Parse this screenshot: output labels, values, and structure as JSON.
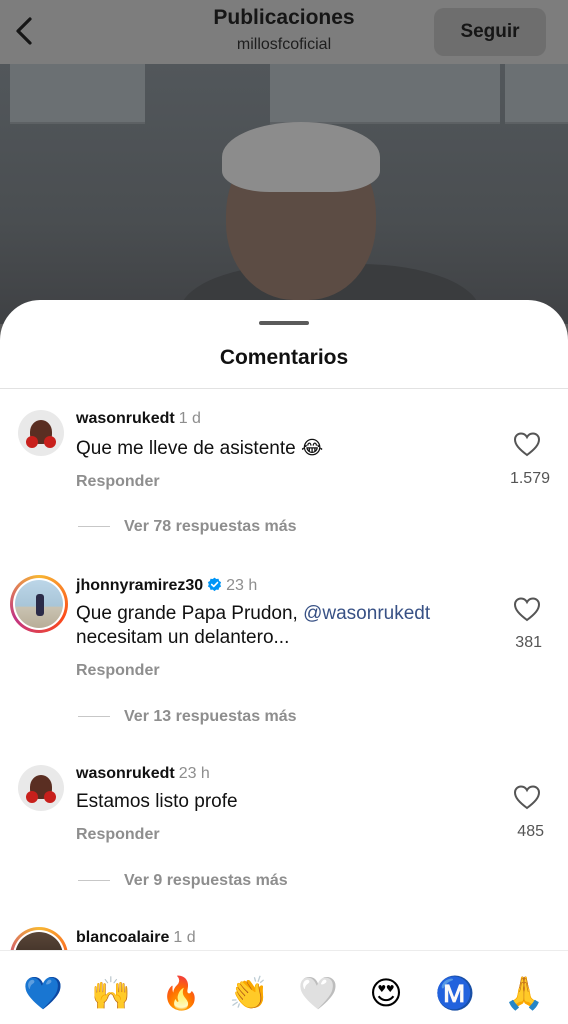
{
  "header": {
    "title": "Publicaciones",
    "subtitle": "millosfcoficial",
    "follow_label": "Seguir"
  },
  "sheet": {
    "title": "Comentarios"
  },
  "comments": [
    {
      "username": "wasonrukedt",
      "time": "1 d",
      "text": "Que me lleve de asistente 😂",
      "reply_label": "Responder",
      "like_count": "1.579",
      "more_replies": "Ver 78 respuestas más"
    },
    {
      "username": "jhonnyramirez30",
      "time": "23 h",
      "text_before": "Que grande Papa Prudon, ",
      "mention": "@wasonrukedt",
      "text_after": "necesitam un delantero...",
      "reply_label": "Responder",
      "like_count": "381",
      "more_replies": "Ver 13 respuestas más"
    },
    {
      "username": "wasonrukedt",
      "time": "23 h",
      "text": "Estamos listo profe",
      "reply_label": "Responder",
      "like_count": "485",
      "more_replies": "Ver 9 respuestas más"
    },
    {
      "username": "blancoalaire",
      "time": "1 d"
    }
  ],
  "emoji_bar": [
    "💙",
    "🙌",
    "🔥",
    "👏",
    "🤍",
    "😍",
    "Ⓜ️",
    "🙏"
  ],
  "icons": {
    "back": "chevron-left-icon",
    "like": "heart-outline-icon",
    "verified": "verified-badge-icon"
  },
  "colors": {
    "mention": "#385185",
    "verified": "#0095f6"
  }
}
